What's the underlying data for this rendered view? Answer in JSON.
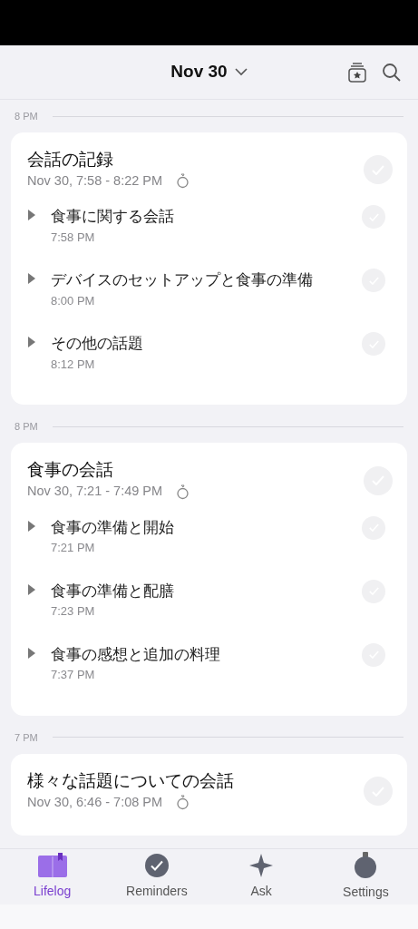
{
  "header": {
    "title": "Nov 30"
  },
  "sections": [
    {
      "hour": "8 PM",
      "title": "会話の記録",
      "time": "Nov 30, 7:58 - 8:22 PM",
      "checked": false,
      "items": [
        {
          "title": "食事に関する会話",
          "time": "7:58 PM",
          "checked": false
        },
        {
          "title": "デバイスのセットアップと食事の準備",
          "time": "8:00 PM",
          "checked": false
        },
        {
          "title": "その他の話題",
          "time": "8:12 PM",
          "checked": false
        }
      ]
    },
    {
      "hour": "8 PM",
      "title": "食事の会話",
      "time": "Nov 30, 7:21 - 7:49 PM",
      "checked": false,
      "items": [
        {
          "title": "食事の準備と開始",
          "time": "7:21 PM",
          "checked": false
        },
        {
          "title": "食事の準備と配膳",
          "time": "7:23 PM",
          "checked": false
        },
        {
          "title": "食事の感想と追加の料理",
          "time": "7:37 PM",
          "checked": false
        }
      ]
    },
    {
      "hour": "7 PM",
      "title": "様々な話題についての会話",
      "time": "Nov 30, 6:46 - 7:08 PM",
      "checked": false
    }
  ],
  "tabs": [
    {
      "kind": "lifelog",
      "label": "Lifelog",
      "selected": true
    },
    {
      "kind": "reminders",
      "label": "Reminders",
      "selected": false
    },
    {
      "kind": "ask",
      "label": "Ask",
      "selected": false
    },
    {
      "kind": "settings",
      "label": "Settings",
      "selected": false
    }
  ]
}
